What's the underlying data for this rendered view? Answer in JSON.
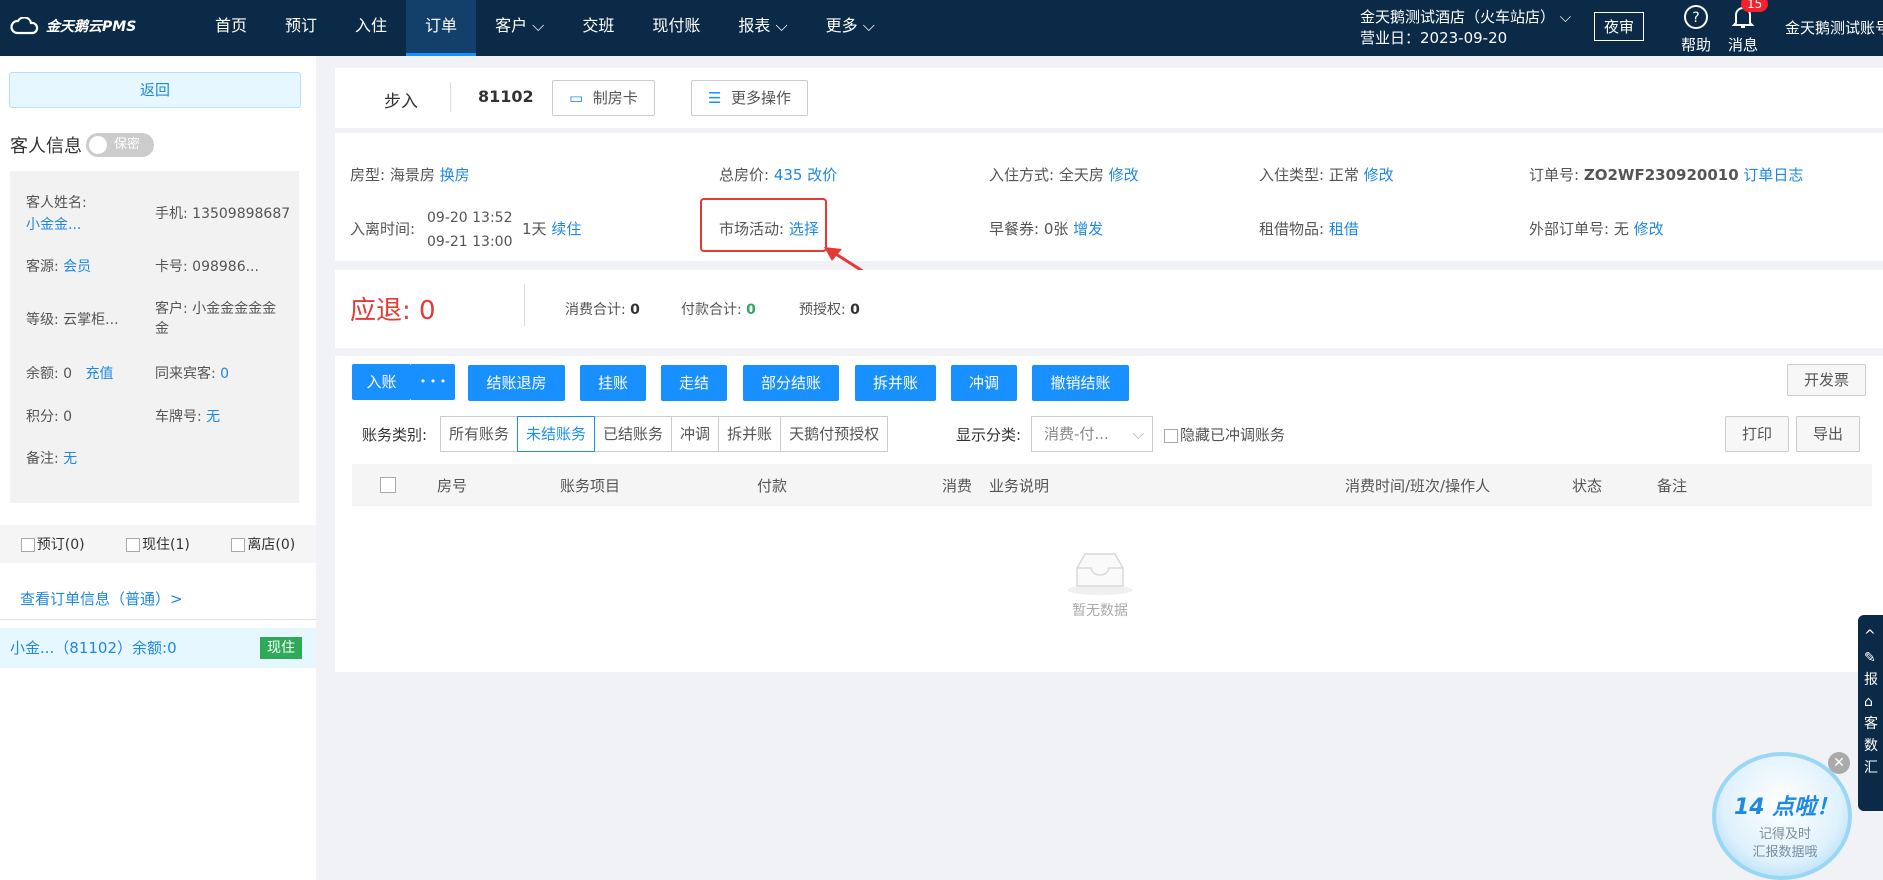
{
  "topbar": {
    "logo_text": "金天鹅云PMS",
    "nav": [
      "首页",
      "预订",
      "入住",
      "订单",
      "客户",
      "交班",
      "现付账",
      "报表",
      "更多"
    ],
    "nav_dropdowns": [
      false,
      false,
      false,
      false,
      true,
      false,
      false,
      true,
      true
    ],
    "active_nav": "订单",
    "hotel_name": "金天鹅测试酒店（火车站店）",
    "business_day": "营业日：2023-09-20",
    "night_audit": "夜审",
    "help_label": "帮助",
    "msg_label": "消息",
    "msg_count": "15",
    "account": "金天鹅测试账号"
  },
  "left": {
    "back": "返回",
    "guest_info_title": "客人信息",
    "privacy_toggle": "保密",
    "guest_name_label": "客人姓名:",
    "guest_name": "小金金...",
    "phone": "手机: 13509898687",
    "source_label": "客源:",
    "source_value": "会员",
    "card_no": "卡号: 098986...",
    "level": "等级: 云掌柜...",
    "customer": "客户: 小金金金金金金",
    "balance": "余额: 0",
    "recharge": "充值",
    "companions_label": "同来宾客:",
    "companions_value": "0",
    "points": "积分: 0",
    "plate_label": "车牌号:",
    "plate_value": "无",
    "remark_label": "备注:",
    "remark_value": "无",
    "filter_reserved": "预订(0)",
    "filter_current": "现住(1)",
    "filter_left": "离店(0)",
    "view_order": "查看订单信息（普通）>",
    "order_item": "小金...（81102）余额:0",
    "order_status": "现住"
  },
  "header": {
    "status": "步入",
    "room_no": "81102",
    "make_card": "制房卡",
    "more_ops": "更多操作"
  },
  "details": {
    "room_type_label": "房型:",
    "room_type": "海景房",
    "change_room": "换房",
    "total_price_label": "总房价:",
    "total_price": "435",
    "change_price": "改价",
    "checkin_mode_label": "入住方式:",
    "checkin_mode": "全天房",
    "modify1": "修改",
    "checkin_type_label": "入住类型:",
    "checkin_type": "正常",
    "modify2": "修改",
    "order_no_label": "订单号:",
    "order_no": "ZO2WF230920010",
    "order_log": "订单日志",
    "stay_time_label": "入离时间:",
    "arrive": "09-20 13:52",
    "depart": "09-21 13:00",
    "nights": "1天",
    "extend": "续住",
    "market_label": "市场活动:",
    "market_select": "选择",
    "breakfast_label": "早餐券:",
    "breakfast": "0张",
    "add_breakfast": "增发",
    "rental_label": "租借物品:",
    "rental": "租借",
    "ext_order_label": "外部订单号:",
    "ext_order": "无",
    "modify3": "修改"
  },
  "summary": {
    "refund_label": "应退:",
    "refund_value": "0",
    "consume_label": "消费合计:",
    "consume_value": "0",
    "paid_label": "付款合计:",
    "paid_value": "0",
    "preauth_label": "预授权:",
    "preauth_value": "0"
  },
  "actions": {
    "post": "入账",
    "more": "• • •",
    "checkout": "结账退房",
    "hang": "挂账",
    "walk": "走结",
    "partial": "部分结账",
    "split": "拆并账",
    "reverse": "冲调",
    "cancel": "撤销结账",
    "invoice": "开发票",
    "print": "打印",
    "export": "导出"
  },
  "account_filter": {
    "label": "账务类别:",
    "tabs": [
      "所有账务",
      "未结账务",
      "已结账务",
      "冲调",
      "拆并账",
      "天鹅付预授权"
    ],
    "active": 1,
    "display_label": "显示分类:",
    "display_value": "消费-付...",
    "hide_reversed": "隐藏已冲调账务"
  },
  "table": {
    "columns": [
      "房号",
      "账务项目",
      "付款",
      "消费",
      "业务说明",
      "消费时间/班次/操作人",
      "状态",
      "备注"
    ],
    "empty": "暂无数据"
  },
  "promo": {
    "title": "14 点啦！",
    "line1": "记得及时",
    "line2": "汇报数据哦"
  },
  "side_tab": [
    "报",
    "客",
    "数",
    "汇"
  ],
  "colors": {
    "nav_bg": "#0b2a47",
    "primary": "#1890ff",
    "refund": "#e53935",
    "green": "#2eaa5a",
    "highlight": "#e53935"
  }
}
